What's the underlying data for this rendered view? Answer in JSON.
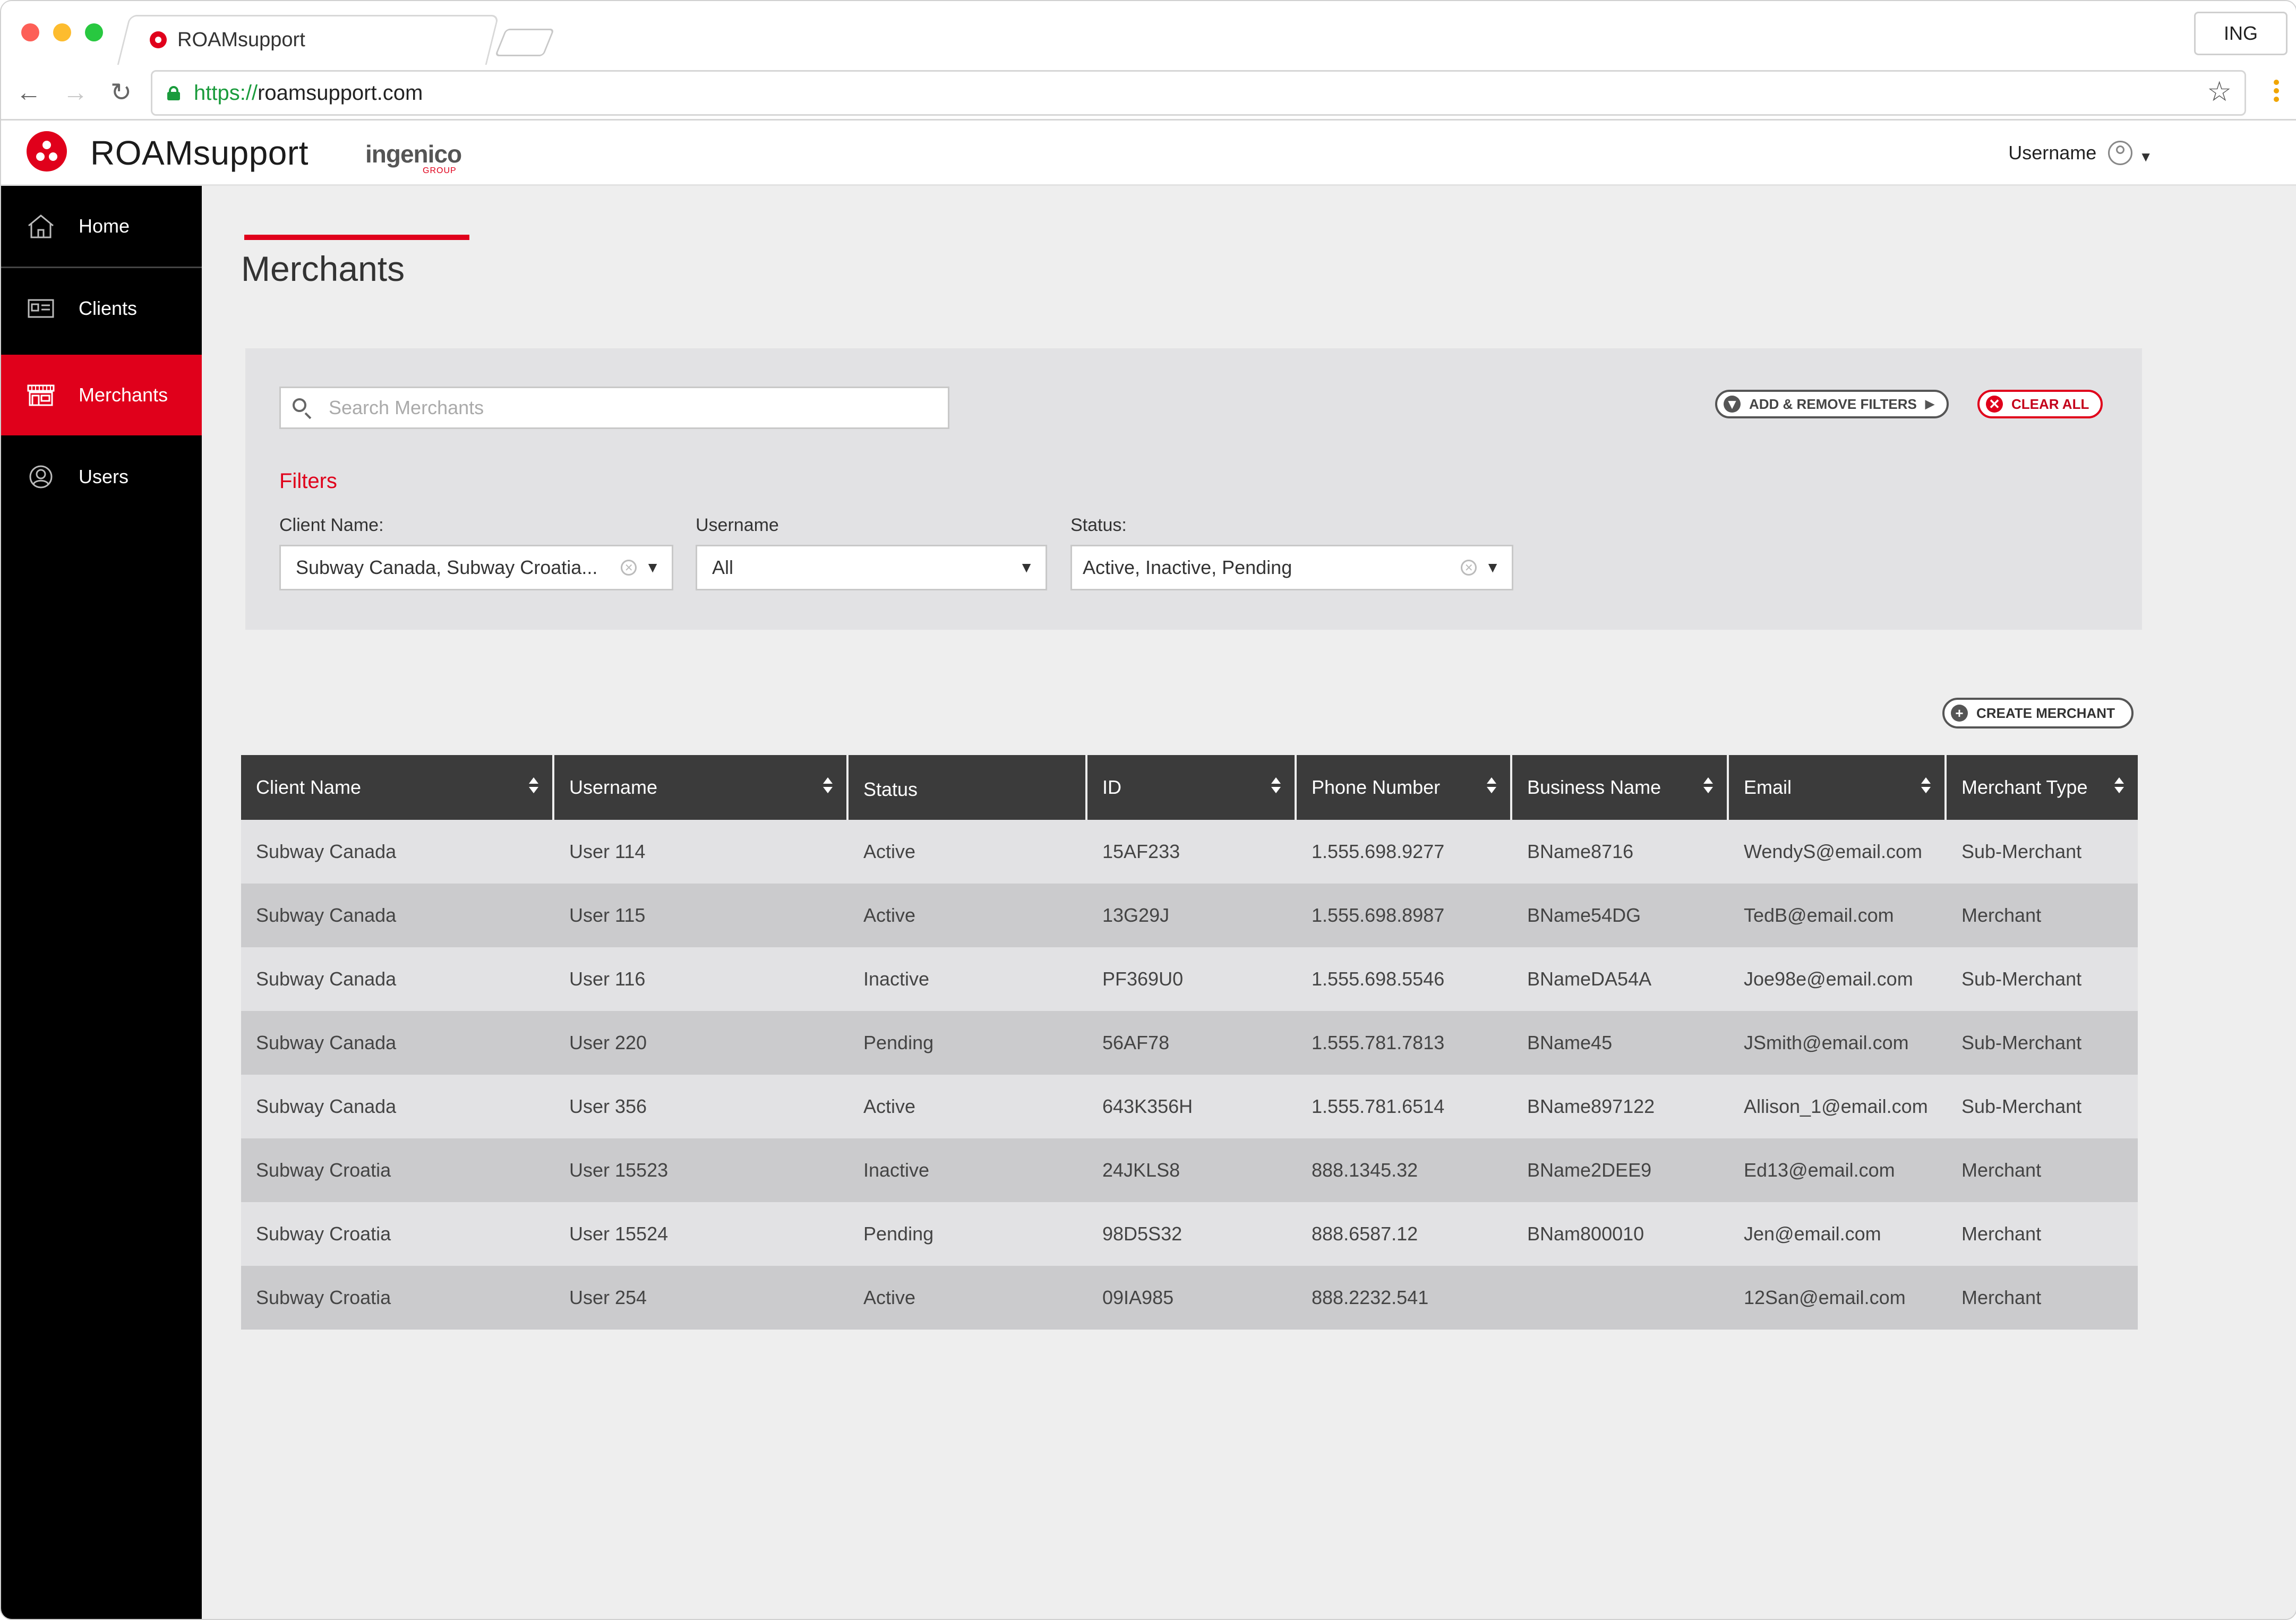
{
  "browser": {
    "tab_title": "ROAMsupport",
    "profile_button": "ING",
    "url_protocol": "https://",
    "url_host": "roamsupport.com"
  },
  "header": {
    "brand": "ROAMsupport",
    "partner": "ingenico",
    "partner_sub": "GROUP",
    "username": "Username"
  },
  "sidebar": {
    "items": [
      {
        "label": "Home",
        "icon": "home-icon"
      },
      {
        "label": "Clients",
        "icon": "id-card-icon"
      },
      {
        "label": "Merchants",
        "icon": "storefront-icon"
      },
      {
        "label": "Users",
        "icon": "user-icon"
      }
    ],
    "active": "Merchants"
  },
  "main": {
    "title": "Merchants",
    "search": {
      "placeholder": "Search Merchants",
      "value": ""
    },
    "buttons": {
      "add_remove_filters": "ADD & REMOVE FILTERS",
      "clear_all": "CLEAR ALL",
      "create_merchant": "CREATE MERCHANT"
    },
    "filters": {
      "heading": "Filters",
      "client_name": {
        "label": "Client Name:",
        "value": "Subway Canada, Subway Croatia..."
      },
      "username": {
        "label": "Username",
        "value": "All"
      },
      "status": {
        "label": "Status:",
        "value": "Active, Inactive, Pending"
      }
    }
  },
  "table": {
    "columns": [
      "Client Name",
      "Username",
      "Status",
      "ID",
      "Phone Number",
      "Business Name",
      "Email",
      "Merchant Type"
    ],
    "sortable": [
      true,
      true,
      false,
      true,
      true,
      true,
      true,
      true
    ],
    "rows": [
      [
        "Subway Canada",
        "User 114",
        "Active",
        "15AF233",
        "1.555.698.9277",
        "BName8716",
        "WendyS@email.com",
        "Sub-Merchant"
      ],
      [
        "Subway Canada",
        "User 115",
        "Active",
        "13G29J",
        "1.555.698.8987",
        "BName54DG",
        "TedB@email.com",
        "Merchant"
      ],
      [
        "Subway Canada",
        "User 116",
        "Inactive",
        "PF369U0",
        "1.555.698.5546",
        "BNameDA54A",
        "Joe98e@email.com",
        "Sub-Merchant"
      ],
      [
        "Subway Canada",
        "User 220",
        "Pending",
        "56AF78",
        "1.555.781.7813",
        "BName45",
        "JSmith@email.com",
        "Sub-Merchant"
      ],
      [
        "Subway Canada",
        "User 356",
        "Active",
        "643K356H",
        "1.555.781.6514",
        "BName897122",
        "Allison_1@email.com",
        "Sub-Merchant"
      ],
      [
        "Subway Croatia",
        "User 15523",
        "Inactive",
        "24JKLS8",
        "888.1345.32",
        "BName2DEE9",
        "Ed13@email.com",
        "Merchant"
      ],
      [
        "Subway Croatia",
        "User 15524",
        "Pending",
        "98D5S32",
        "888.6587.12",
        "BNam800010",
        "Jen@email.com",
        "Merchant"
      ],
      [
        "Subway Croatia",
        "User 254",
        "Active",
        "09IA985",
        "888.2232.541",
        "",
        "12San@email.com",
        "Merchant"
      ]
    ]
  },
  "colors": {
    "accent": "#e0001b",
    "sidebar_bg": "#000000",
    "table_header": "#3b3b3b"
  }
}
